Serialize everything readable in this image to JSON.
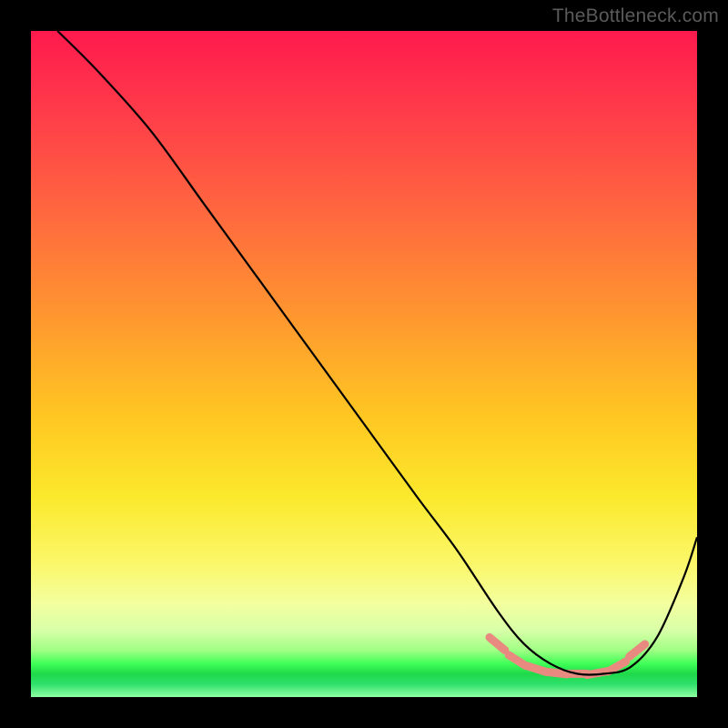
{
  "watermark": "TheBottleneck.com",
  "chart_data": {
    "type": "line",
    "title": "",
    "xlabel": "",
    "ylabel": "",
    "xlim": [
      0,
      100
    ],
    "ylim": [
      0,
      100
    ],
    "grid": false,
    "legend": false,
    "series": [
      {
        "name": "bottleneck-curve",
        "color": "#000000",
        "x": [
          4,
          10,
          18,
          26,
          34,
          42,
          50,
          58,
          64,
          70,
          74,
          78,
          82,
          86,
          90,
          94,
          98,
          100
        ],
        "y": [
          100,
          94,
          85,
          74,
          63,
          52,
          41,
          30,
          22,
          13,
          8,
          5,
          3.5,
          3.5,
          4.5,
          9,
          18,
          24
        ]
      },
      {
        "name": "highlight-band",
        "color": "#e88a80",
        "type": "scatter",
        "x": [
          70,
          73,
          76,
          79,
          82,
          85,
          88,
          91
        ],
        "y": [
          8,
          5.5,
          4.2,
          3.6,
          3.5,
          3.6,
          4.6,
          7
        ]
      }
    ],
    "annotations": []
  }
}
